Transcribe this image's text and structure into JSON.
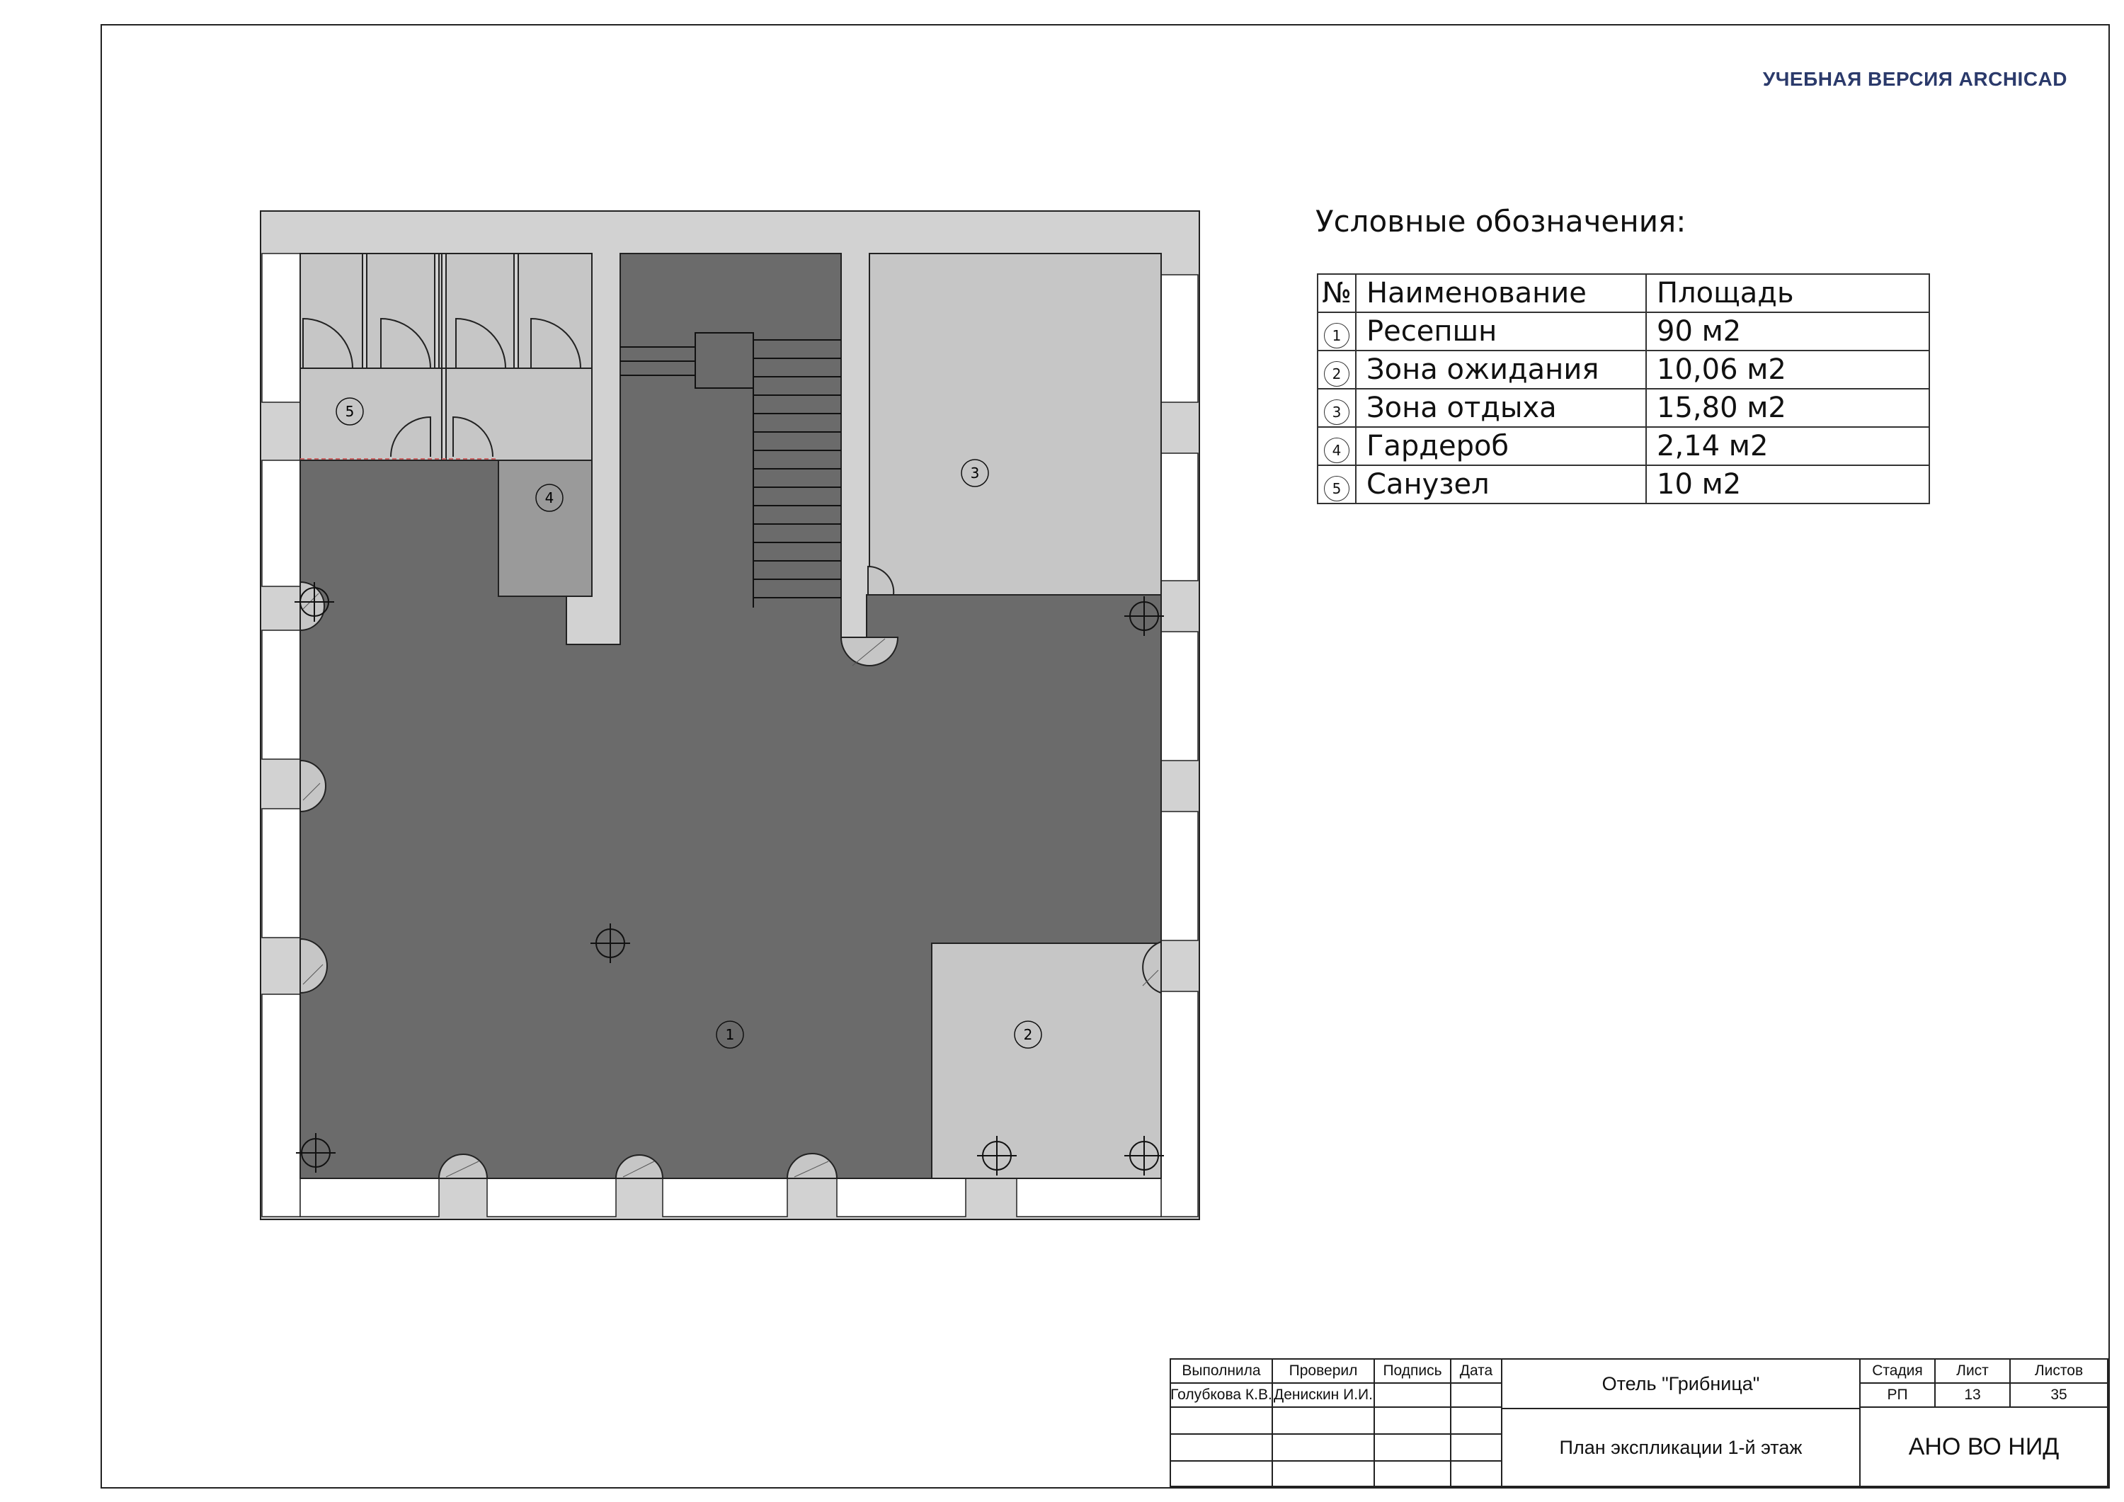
{
  "watermark": "УЧЕБНАЯ ВЕРСИЯ ARCHICAD",
  "legend": {
    "title": "Условные обозначения:",
    "headers": {
      "num": "№",
      "name": "Наименование",
      "area": "Площадь"
    },
    "rows": [
      {
        "num": "1",
        "name": "Ресепшн",
        "area": "90 м2"
      },
      {
        "num": "2",
        "name": "Зона ожидания",
        "area": "10,06 м2"
      },
      {
        "num": "3",
        "name": "Зона отдыха",
        "area": "15,80 м2"
      },
      {
        "num": "4",
        "name": "Гардероб",
        "area": "2,14 м2"
      },
      {
        "num": "5",
        "name": "Санузел",
        "area": "10 м2"
      }
    ]
  },
  "plan": {
    "room_tags": [
      "1",
      "2",
      "3",
      "4",
      "5"
    ],
    "colors": {
      "floor_dark": "#6b6b6b",
      "room_light": "#c6c6c6",
      "wardrobe": "#9a9a9a",
      "wall": "#d2d2d2",
      "window": "#ffffff",
      "line": "#222222"
    }
  },
  "stamp": {
    "headers": {
      "executed": "Выполнила",
      "checked": "Проверил",
      "signature": "Подпись",
      "date": "Дата"
    },
    "executed_by": "Голубкова К.В.",
    "checked_by": "Денискин И.И.",
    "project": "Отель \"Грибница\"",
    "sheet_title": "План экспликации 1-й этаж",
    "stage_label": "Стадия",
    "sheet_label": "Лист",
    "sheets_label": "Листов",
    "stage": "РП",
    "sheet": "13",
    "sheets": "35",
    "organization": "АНО ВО НИД"
  }
}
